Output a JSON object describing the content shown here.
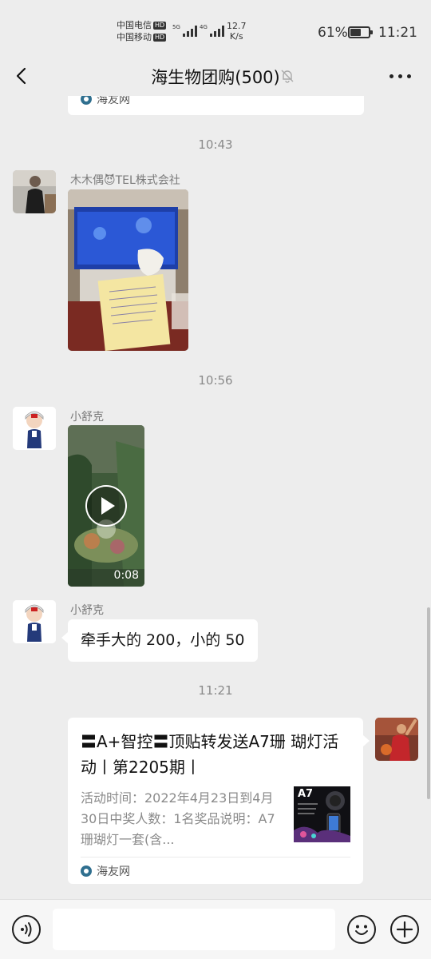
{
  "status_bar": {
    "carrier_1": "中国电信",
    "carrier_2": "中国移动",
    "hd_badge": "HD",
    "net_1": "5G",
    "net_2": "4G",
    "speed_value": "12.7",
    "speed_unit": "K/s",
    "battery_percent": "61%",
    "battery_level": 0.61,
    "time": "11:21"
  },
  "header": {
    "title": "海生物团购(500)",
    "back_icon": "chevron-left-icon",
    "mute_icon": "bell-off-icon",
    "more_icon": "more-dots-icon"
  },
  "chat": {
    "top_card_source": "海友网",
    "timestamps": [
      "10:43",
      "10:56",
      "11:21"
    ],
    "msg_1": {
      "sender": "木木偶😈TEL株式会社",
      "type": "image"
    },
    "msg_2": {
      "sender": "小舒克",
      "type": "video",
      "duration": "0:08"
    },
    "msg_3": {
      "sender": "小舒克",
      "text": "牵手大的 200，小的 50"
    },
    "msg_4": {
      "type": "link-card",
      "title": "〓A+智控〓顶贴转发送A7珊 瑚灯活动丨第2205期丨",
      "description": "活动时间：2022年4月23日到4月30日中奖人数：1名奖品说明：A7珊瑚灯一套(含...",
      "thumb_label": "A7",
      "source": "海友网"
    }
  },
  "input_bar": {
    "voice_icon": "voice-icon",
    "emoji_icon": "emoji-icon",
    "plus_icon": "plus-icon"
  },
  "colors": {
    "background": "#ededed",
    "bubble": "#ffffff",
    "timestamp": "#8a8a8a",
    "text": "#191919"
  }
}
